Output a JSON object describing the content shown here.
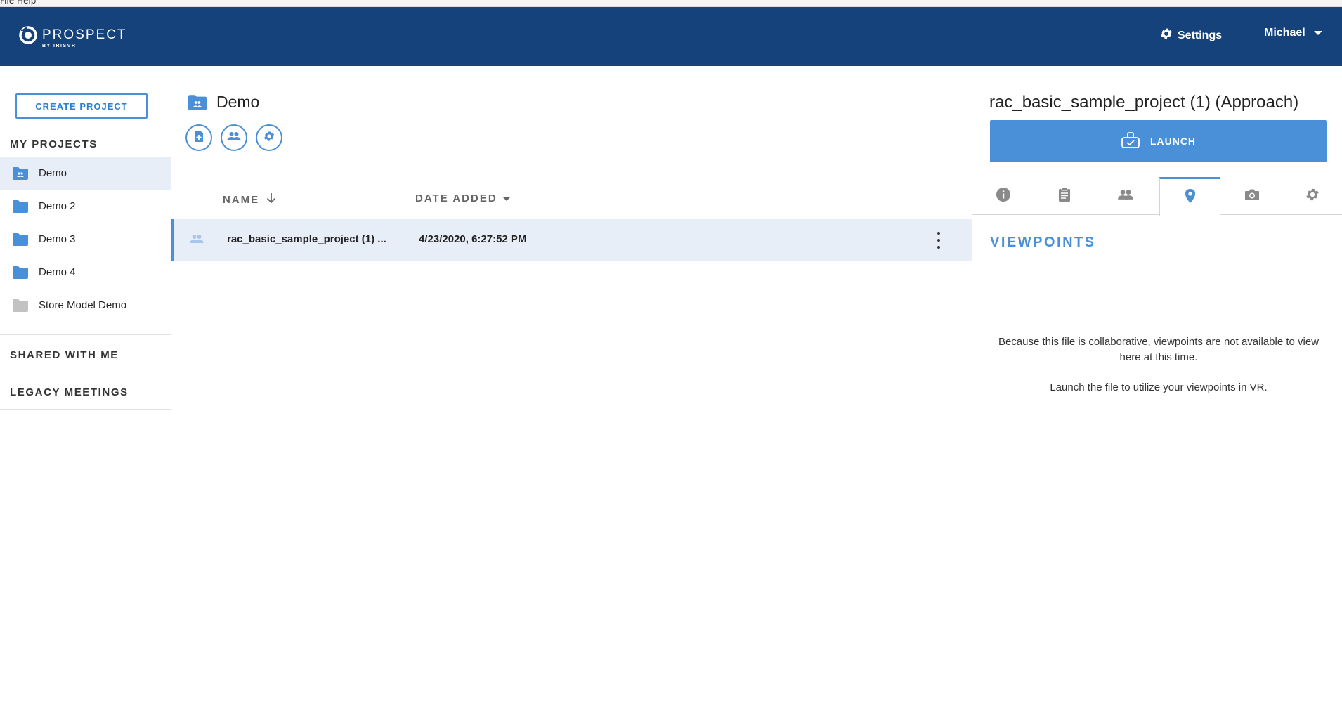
{
  "menubar": {
    "file": "File",
    "help": "Help"
  },
  "header": {
    "logo_title": "PROSPECT",
    "logo_sub": "BY IRISVR",
    "settings_label": "Settings",
    "user_name": "Michael",
    "bg_color": "#15427b"
  },
  "sidebar": {
    "create_button": "CREATE PROJECT",
    "my_projects_title": "MY PROJECTS",
    "projects": [
      {
        "label": "Demo",
        "icon": "shared-folder-icon",
        "active": true
      },
      {
        "label": "Demo 2",
        "icon": "folder-icon"
      },
      {
        "label": "Demo 3",
        "icon": "folder-icon"
      },
      {
        "label": "Demo 4",
        "icon": "folder-icon"
      },
      {
        "label": "Store Model Demo",
        "icon": "folder-grey-icon"
      }
    ],
    "shared_title": "SHARED WITH ME",
    "legacy_title": "LEGACY MEETINGS"
  },
  "main": {
    "folder_title": "Demo",
    "actions": [
      "add-file-icon",
      "members-icon",
      "gear-icon"
    ],
    "columns": {
      "name": "NAME",
      "date": "DATE ADDED"
    },
    "rows": [
      {
        "name": "rac_basic_sample_project (1) ...",
        "date": "4/23/2020, 6:27:52 PM"
      }
    ]
  },
  "panel": {
    "title": "rac_basic_sample_project (1) (Approach)",
    "launch_label": "LAUNCH",
    "tabs": [
      "info-icon",
      "notes-icon",
      "people-icon",
      "location-pin-icon",
      "camera-icon",
      "gear-icon"
    ],
    "active_tab": 3,
    "section_heading": "VIEWPOINTS",
    "message_1": "Because this file is collaborative, viewpoints are not available to view here at this time.",
    "message_2": "Launch the file to utilize your viewpoints in VR."
  },
  "colors": {
    "accent": "#4a90d9",
    "header": "#15427b",
    "selected_row": "#e7eef7"
  }
}
